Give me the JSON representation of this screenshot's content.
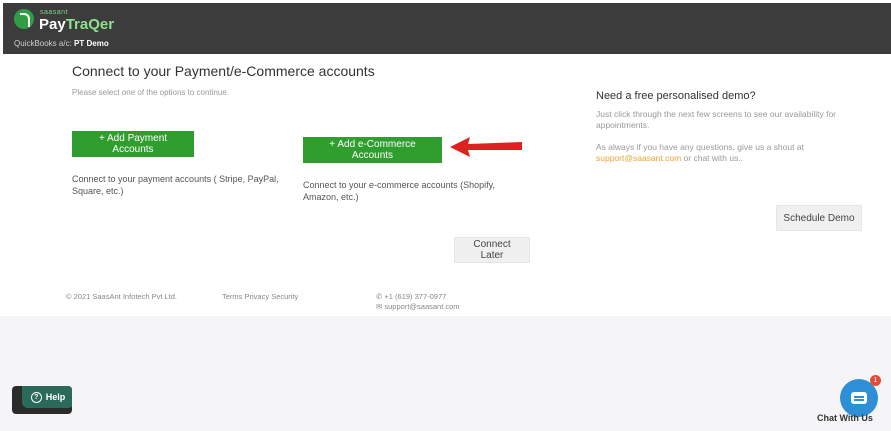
{
  "header": {
    "brand_small": "saasant",
    "brand_a": "Pay",
    "brand_b": "TraQer",
    "account_label": "QuickBooks a/c:",
    "account_name": "PT Demo"
  },
  "main": {
    "title": "Connect to your Payment/e-Commerce accounts",
    "subtitle": "Please select one of the options to continue.",
    "payment_button": "+ Add Payment Accounts",
    "payment_desc": "Connect to your payment accounts ( Stripe, PayPal, Square, etc.)",
    "ecommerce_button": "+ Add e-Commerce Accounts",
    "ecommerce_desc": "Connect to your e-commerce accounts (Shopify, Amazon, etc.)",
    "connect_later": "Connect Later"
  },
  "demo": {
    "title": "Need a free personalised demo?",
    "line1": "Just click through the next few screens to see our availability for appointments.",
    "line2_prefix": "As always if you have any questions, give us a shout at",
    "email": "support@saasant.com",
    "line2_suffix": "or chat with us..",
    "schedule_button": "Schedule Demo"
  },
  "footer": {
    "copyright": "© 2021 SaasAnt Infotech Pvt Ltd.",
    "terms": "Terms",
    "privacy": "Privacy",
    "security": "Security",
    "phone": "+1 (619) 377-0977",
    "email": "support@saasant.com"
  },
  "widgets": {
    "help_label": "Help",
    "chat_label": "Chat With Us",
    "chat_badge": "1"
  },
  "colors": {
    "primary_green": "#2f9e2f",
    "topbar": "#3c3c3c",
    "link_orange": "#e8a33a",
    "arrow_red": "#e02020",
    "chat_blue": "#2f8fd6"
  }
}
